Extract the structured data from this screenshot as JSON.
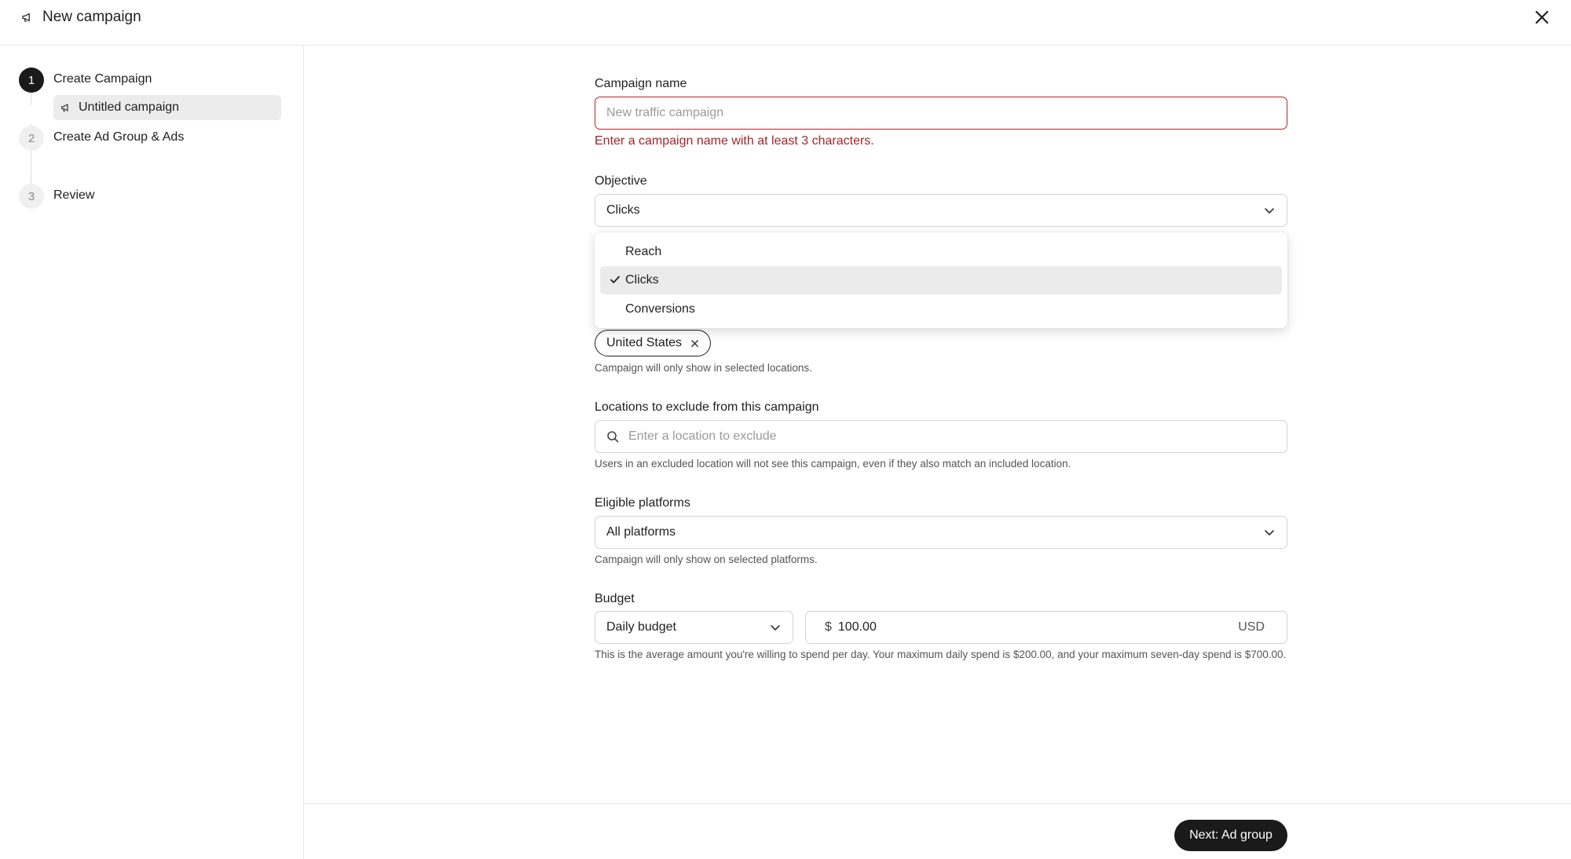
{
  "header": {
    "title": "New campaign",
    "icon": "megaphone-icon",
    "close_icon": "close-icon"
  },
  "sidebar": {
    "steps": [
      {
        "number": "1",
        "label": "Create Campaign",
        "active": true
      },
      {
        "number": "2",
        "label": "Create Ad Group & Ads",
        "active": false
      },
      {
        "number": "3",
        "label": "Review",
        "active": false
      }
    ],
    "sub_item": {
      "label": "Untitled campaign",
      "icon": "megaphone-icon"
    }
  },
  "form": {
    "campaign_name": {
      "label": "Campaign name",
      "placeholder": "New traffic campaign",
      "value": "",
      "error": "Enter a campaign name with at least 3 characters."
    },
    "objective": {
      "label": "Objective",
      "value": "Clicks",
      "options": [
        "Reach",
        "Clicks",
        "Conversions"
      ],
      "selected_index": 1
    },
    "locations_include": {
      "chip": "United States",
      "help": "Campaign will only show in selected locations."
    },
    "locations_exclude": {
      "label": "Locations to exclude from this campaign",
      "placeholder": "Enter a location to exclude",
      "help": "Users in an excluded location will not see this campaign, even if they also match an included location."
    },
    "platforms": {
      "label": "Eligible platforms",
      "value": "All platforms",
      "help": "Campaign will only show on selected platforms."
    },
    "budget": {
      "label": "Budget",
      "type": "Daily budget",
      "currency_symbol": "$",
      "amount": "100.00",
      "currency": "USD",
      "help": "This is the average amount you're willing to spend per day. Your maximum daily spend is $200.00, and your maximum seven-day spend is $700.00."
    }
  },
  "footer": {
    "next_label": "Next: Ad group"
  },
  "colors": {
    "error": "#b3262a",
    "primary": "#1a1a1a",
    "selected_bg": "#ebebeb"
  }
}
